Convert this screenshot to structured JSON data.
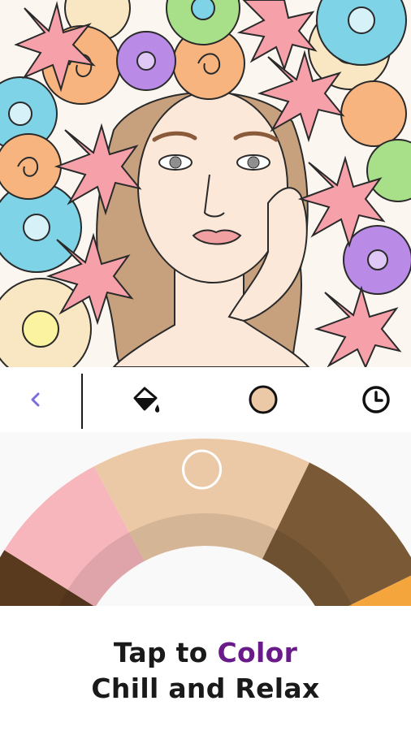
{
  "toolbar": {
    "back_icon": "chevron-left-icon",
    "fill_icon": "paint-bucket-icon",
    "selected_color_icon": "color-swatch-icon",
    "history_icon": "clock-icon",
    "accent_color": "#7b6fe0",
    "selected_color": "#ecc9a6"
  },
  "palette": {
    "swatches": [
      {
        "name": "dark-brown",
        "color": "#5a3a1e"
      },
      {
        "name": "pink",
        "color": "#f7b6bc"
      },
      {
        "name": "peach",
        "color": "#ecc9a6"
      },
      {
        "name": "brown",
        "color": "#7a5a36"
      },
      {
        "name": "orange",
        "color": "#f4a53c"
      }
    ],
    "selected_index": 2
  },
  "tagline": {
    "prefix": "Tap to ",
    "highlight": "Color",
    "highlight_color": "#6a1b8a",
    "line2": "Chill and Relax"
  }
}
